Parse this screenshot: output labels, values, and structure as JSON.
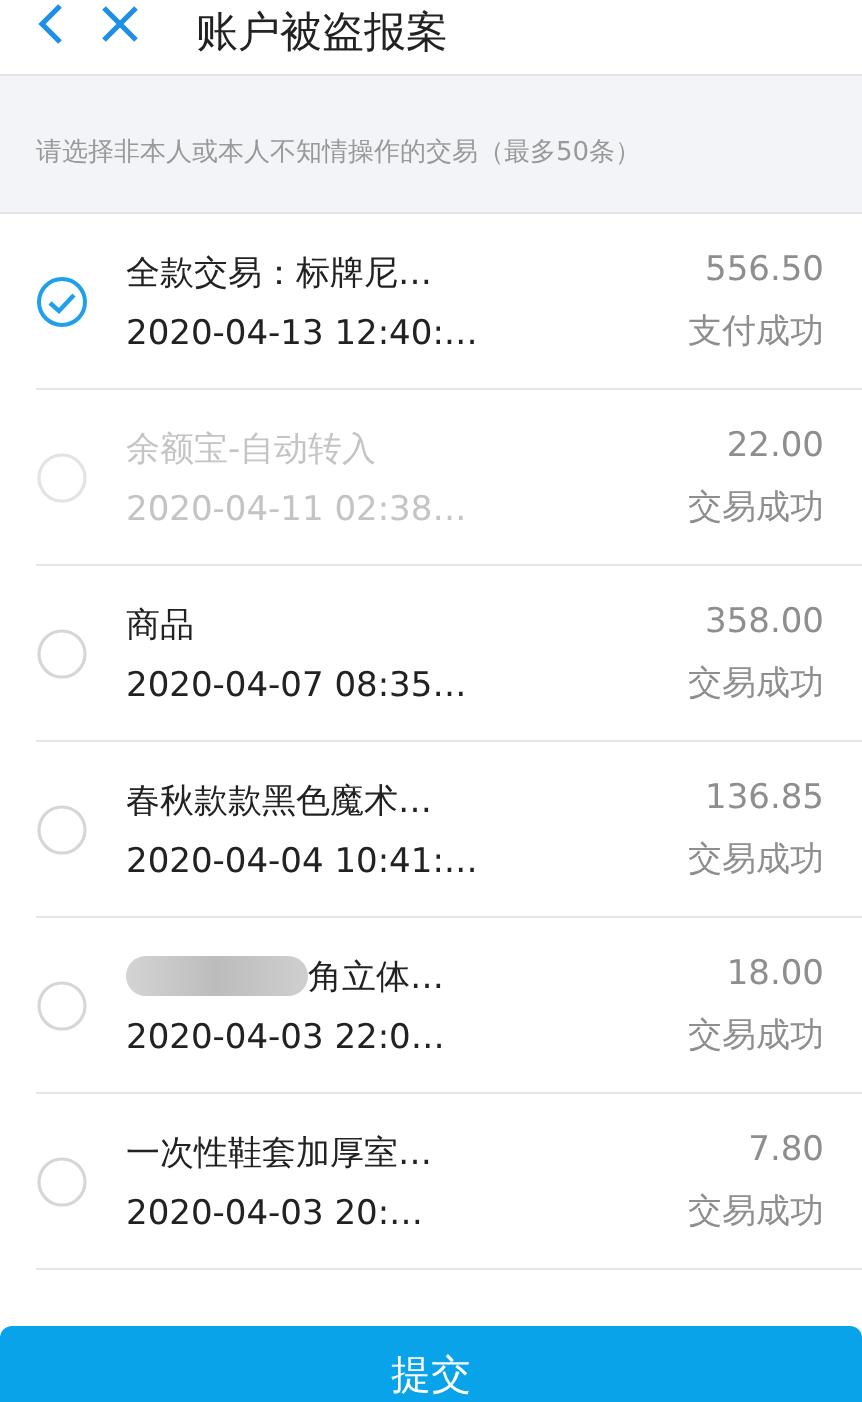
{
  "header": {
    "title": "账户被盗报案"
  },
  "hint": "请选择非本人或本人不知情操作的交易（最多50条）",
  "transactions": [
    {
      "title": "全款交易：标牌尼…",
      "time": "2020-04-13 12:40:…",
      "amount": "556.50",
      "status": "支付成功",
      "selected": true,
      "disabled": false,
      "redacted": false
    },
    {
      "title": "余额宝-自动转入",
      "time": "2020-04-11 02:38…",
      "amount": "22.00",
      "status": "交易成功",
      "selected": false,
      "disabled": true,
      "redacted": false
    },
    {
      "title": "商品",
      "time": "2020-04-07 08:35…",
      "amount": "358.00",
      "status": "交易成功",
      "selected": false,
      "disabled": false,
      "redacted": false
    },
    {
      "title": "春秋款款黑色魔术…",
      "time": "2020-04-04 10:41:…",
      "amount": "136.85",
      "status": "交易成功",
      "selected": false,
      "disabled": false,
      "redacted": false
    },
    {
      "title": "角立体…",
      "time": "2020-04-03 22:0…",
      "amount": "18.00",
      "status": "交易成功",
      "selected": false,
      "disabled": false,
      "redacted": true
    },
    {
      "title": "一次性鞋套加厚室…",
      "time": "2020-04-03 20:…",
      "amount": "7.80",
      "status": "交易成功",
      "selected": false,
      "disabled": false,
      "redacted": false
    }
  ],
  "submit": "提交"
}
